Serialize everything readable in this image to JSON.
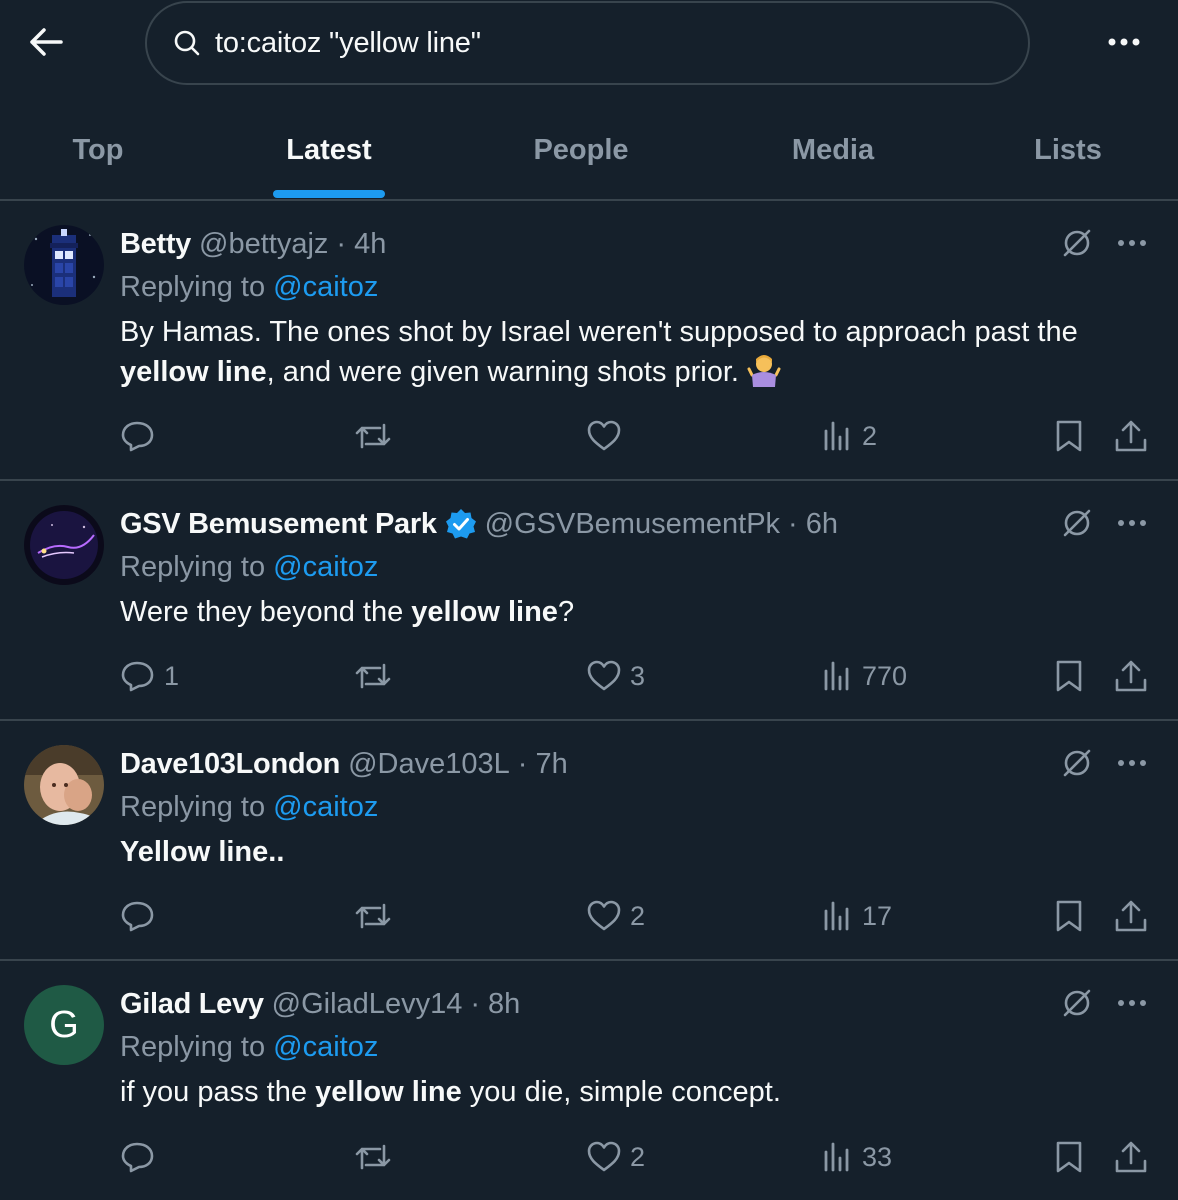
{
  "search": {
    "query": "to:caitoz \"yellow line\""
  },
  "tabs": [
    {
      "label": "Top"
    },
    {
      "label": "Latest"
    },
    {
      "label": "People"
    },
    {
      "label": "Media"
    },
    {
      "label": "Lists"
    }
  ],
  "active_tab": "Latest",
  "colors": {
    "background": "#15202b",
    "accent": "#1d9bf0",
    "muted": "#8b98a5",
    "divider": "#38444d"
  },
  "tweets": [
    {
      "name": "Betty",
      "handle": "@bettyajz",
      "time": "· 4h",
      "replying_prefix": "Replying to",
      "replying_to": "@caitoz",
      "text_parts": [
        "By Hamas. The ones shot by Israel weren't supposed to approach past the ",
        "yellow line",
        ", and were given warning shots prior. "
      ],
      "emoji": "person-shrugging",
      "replies": "",
      "reposts": "",
      "likes": "",
      "views": "2"
    },
    {
      "name": "GSV Bemusement Park",
      "handle": "@GSVBemusementPk",
      "time": "· 6h",
      "verified": true,
      "replying_prefix": "Replying to",
      "replying_to": "@caitoz",
      "text_parts": [
        "Were they beyond the ",
        "yellow line",
        "?"
      ],
      "replies": "1",
      "reposts": "",
      "likes": "3",
      "views": "770"
    },
    {
      "name": "Dave103London",
      "handle": "@Dave103L",
      "time": "· 7h",
      "replying_prefix": "Replying to",
      "replying_to": "@caitoz",
      "text_parts": [
        "Yellow line.."
      ],
      "replies": "",
      "reposts": "",
      "likes": "2",
      "views": "17"
    },
    {
      "name": "Gilad Levy",
      "handle": "@GiladLevy14",
      "time": "· 8h",
      "avatar_letter": "G",
      "replying_prefix": "Replying to",
      "replying_to": "@caitoz",
      "text_parts": [
        "if you pass the ",
        "yellow line",
        " you die, simple concept."
      ],
      "replies": "",
      "reposts": "",
      "likes": "2",
      "views": "33"
    }
  ]
}
